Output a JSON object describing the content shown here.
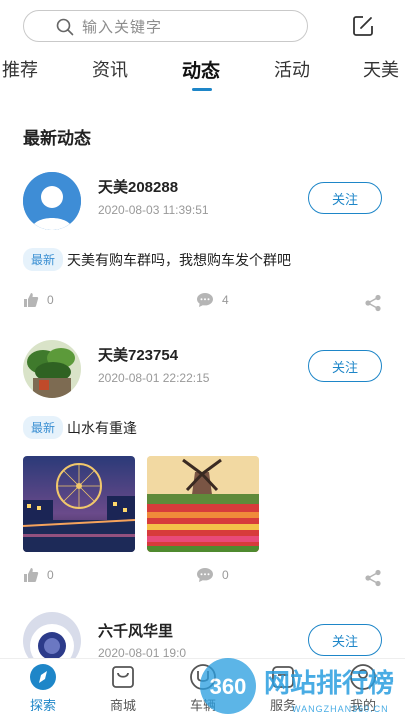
{
  "search": {
    "placeholder": "输入关键字"
  },
  "tabs": [
    {
      "label": "推荐"
    },
    {
      "label": "资讯"
    },
    {
      "label": "动态"
    },
    {
      "label": "活动"
    },
    {
      "label": "天美"
    }
  ],
  "section_title": "最新动态",
  "posts": [
    {
      "username": "天美208288",
      "time": "2020-08-03 11:39:51",
      "follow_label": "关注",
      "badge": "最新",
      "content": "天美有购车群吗，我想购车发个群吧",
      "likes": "0",
      "comments": "4"
    },
    {
      "username": "天美723754",
      "time": "2020-08-01 22:22:15",
      "follow_label": "关注",
      "badge": "最新",
      "content": "山水有重逢",
      "likes": "0",
      "comments": "0"
    },
    {
      "username": "六千风华里",
      "time": "2020-08-01 19:0",
      "follow_label": "关注"
    }
  ],
  "bottom_nav": [
    {
      "label": "探索",
      "icon": "compass-icon",
      "active": true
    },
    {
      "label": "商城",
      "icon": "shopping-bag-icon"
    },
    {
      "label": "车辆",
      "icon": "car-icon"
    },
    {
      "label": "服务",
      "icon": "service-icon"
    },
    {
      "label": "我的",
      "icon": "user-icon"
    }
  ],
  "watermark": {
    "logo_text": "360",
    "title": "网站排行榜",
    "subtitle": "WANGZHAN360.CN"
  },
  "colors": {
    "accent": "#1e86c8",
    "badge_bg": "#e6f2fb"
  }
}
